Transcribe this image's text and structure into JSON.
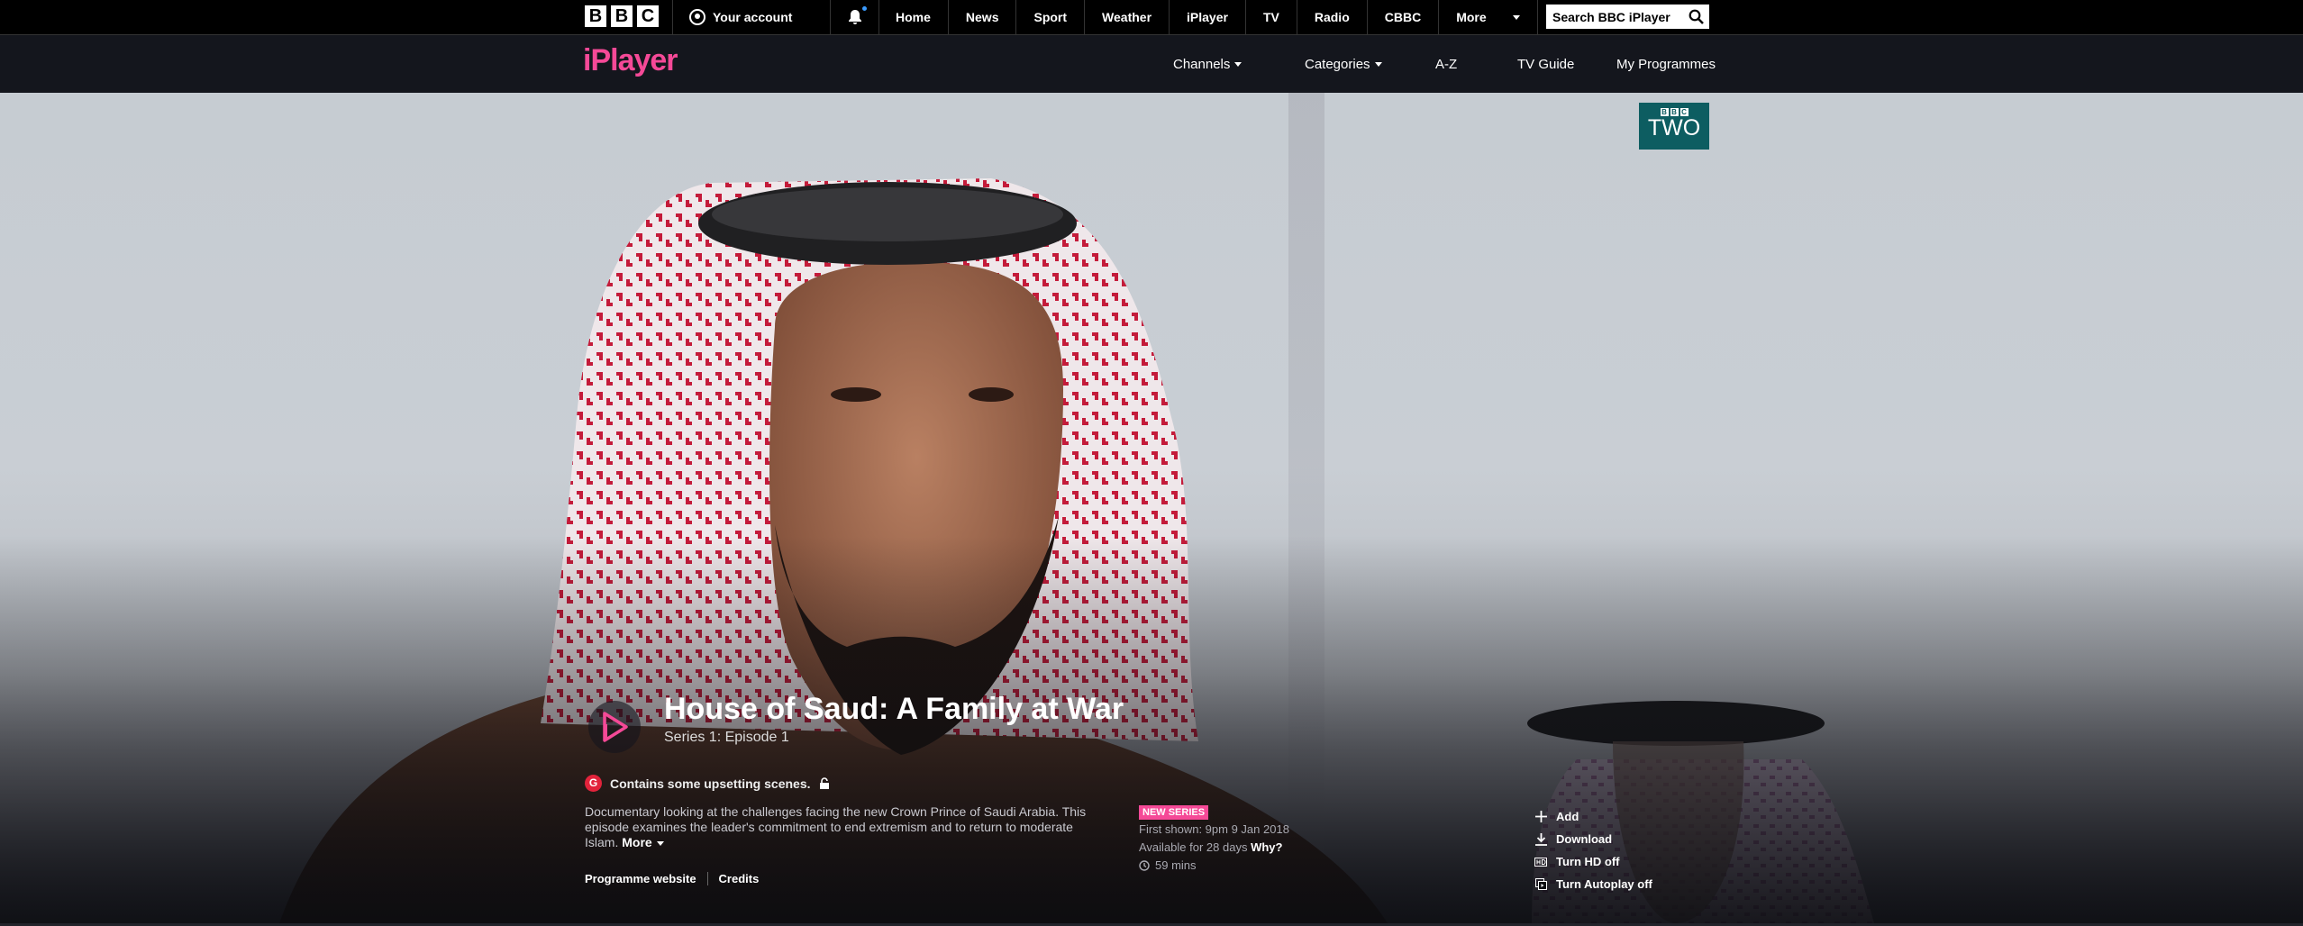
{
  "global_nav": {
    "logo_letters": [
      "B",
      "B",
      "C"
    ],
    "account_label": "Your account",
    "links": [
      "Home",
      "News",
      "Sport",
      "Weather",
      "iPlayer",
      "TV",
      "Radio",
      "CBBC"
    ],
    "more_label": "More",
    "search_placeholder": "Search BBC iPlayer"
  },
  "iplayer_nav": {
    "logo": "iPlayer",
    "channels_label": "Channels",
    "categories_label": "Categories",
    "az_label": "A-Z",
    "tv_guide_label": "TV Guide",
    "my_programmes_label": "My Programmes"
  },
  "channel_badge": {
    "small_letters": [
      "B",
      "B",
      "C"
    ],
    "name": "TWO",
    "color": "#0d5d61"
  },
  "programme": {
    "title": "House of Saud: A Family at War",
    "subtitle": "Series 1: Episode 1",
    "guidance_badge": "G",
    "guidance_text": "Contains some upsetting scenes.",
    "description": "Documentary looking at the challenges facing the new Crown Prince of Saudi Arabia. This episode examines the leader's commitment to end extremism and to return to moderate Islam.",
    "more_label": "More",
    "programme_website_label": "Programme website",
    "credits_label": "Credits"
  },
  "meta": {
    "badge": "NEW SERIES",
    "first_shown": "First shown: 9pm 9 Jan 2018",
    "available": "Available for 28 days",
    "why_label": "Why?",
    "duration": "59 mins"
  },
  "actions": {
    "add": "Add",
    "download": "Download",
    "hd": "Turn HD off",
    "autoplay": "Turn Autoplay off"
  },
  "colors": {
    "brand_pink": "#f54997",
    "guidance_red": "#e2233b",
    "bbc_two_teal": "#0d5d61"
  }
}
